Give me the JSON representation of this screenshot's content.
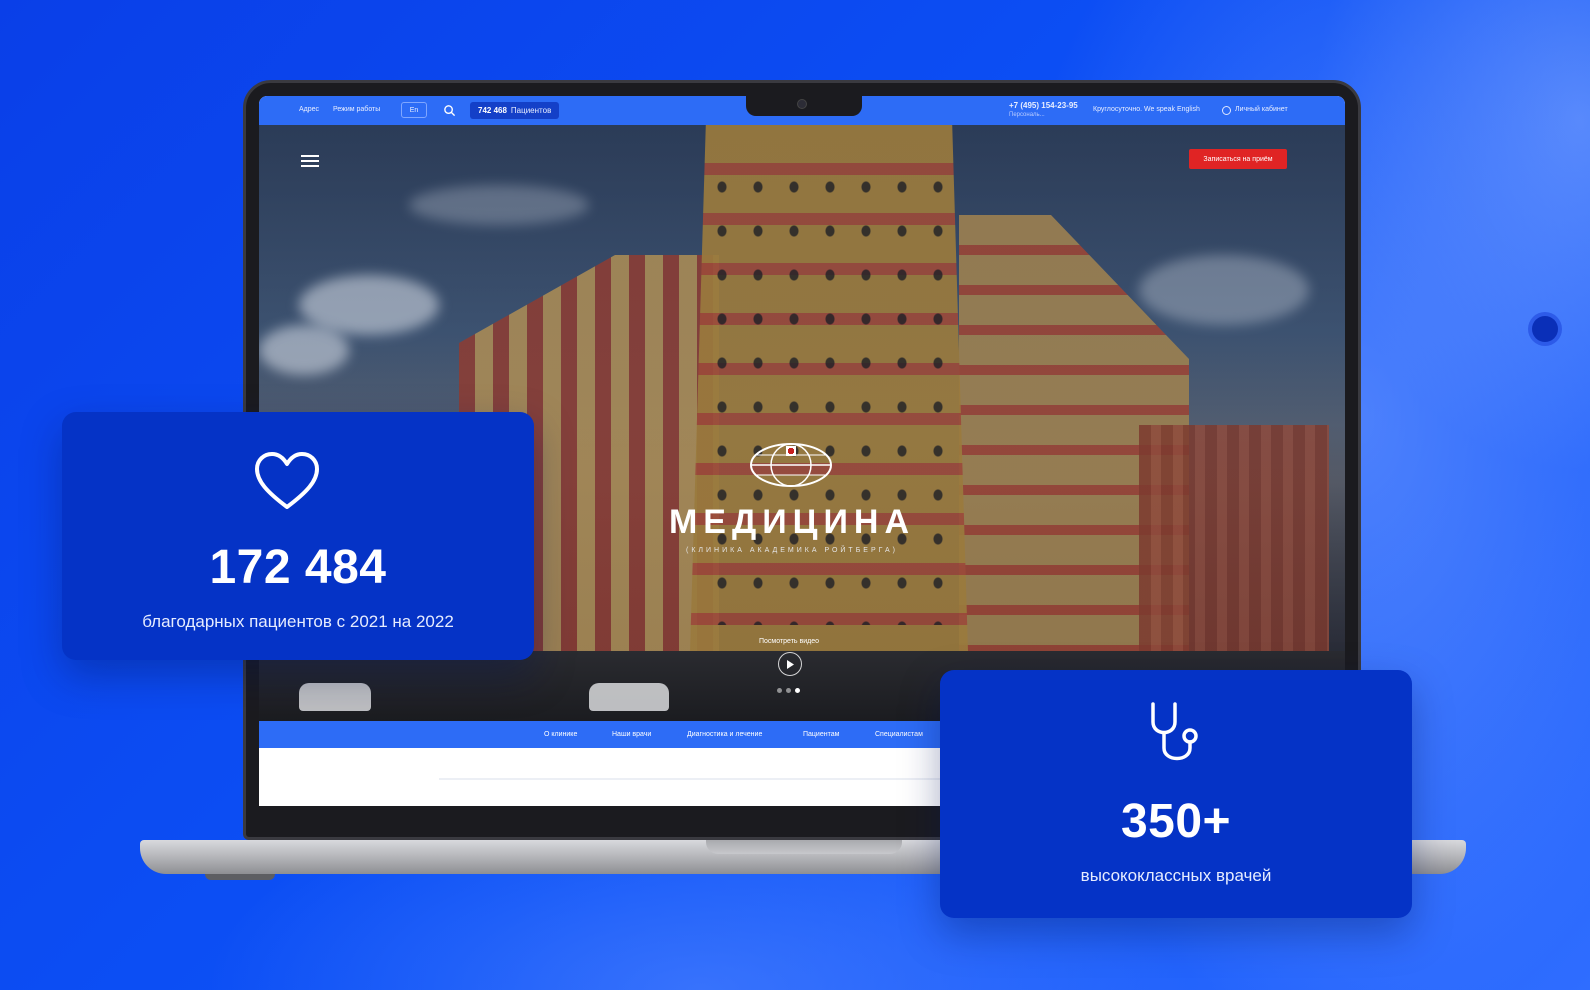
{
  "site": {
    "topbar": {
      "address_label": "Адрес",
      "hours_label": "Режим работы",
      "lang_label": "En",
      "patients_count": "742 468",
      "patients_label": "Пациентов",
      "phone": "+7 (495) 154-23-95",
      "phone_note": "Персональ...",
      "languages_note": "Круглосуточно. We speak English",
      "cabinet_label": "Личный кабинет"
    },
    "hero": {
      "cta_label": "Записаться на приём",
      "title": "МЕДИЦИНА",
      "subtitle": "(КЛИНИКА АКАДЕМИКА РОЙТБЕРГА)",
      "video_label": "Посмотреть видео"
    },
    "nav": [
      "О клинике",
      "Наши врачи",
      "Диагностика и лечение",
      "Пациентам",
      "Специалистам"
    ]
  },
  "cards": {
    "patients": {
      "icon": "heart-icon",
      "value": "172 484",
      "caption": "благодарных пациентов с 2021 на 2022"
    },
    "doctors": {
      "icon": "stethoscope-icon",
      "value": "350+",
      "caption": "высококлассных врачей"
    }
  },
  "colors": {
    "background": "#0a4cf0",
    "card": "#0533c6",
    "site_accent": "#2d6cf6",
    "cta": "#e02424"
  }
}
